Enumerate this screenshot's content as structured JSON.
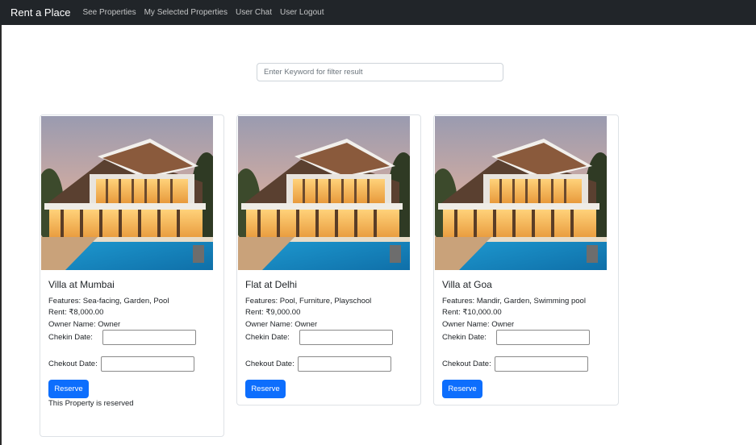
{
  "navbar": {
    "brand": "Rent a Place",
    "links": [
      {
        "label": "See Properties"
      },
      {
        "label": "My Selected Properties"
      },
      {
        "label": "User Chat"
      },
      {
        "label": "User Logout"
      }
    ]
  },
  "search": {
    "placeholder": "Enter Keyword for filter result",
    "value": ""
  },
  "properties": [
    {
      "title": "Villa at Mumbai",
      "features": "Features: Sea-facing, Garden, Pool",
      "rent": "Rent: ₹8,000.00",
      "owner": "Owner Name: Owner",
      "checkin_label": "Chekin Date:",
      "checkout_label": "Chekout Date:",
      "button_label": "Reserve",
      "status": "This Property is reserved"
    },
    {
      "title": "Flat at Delhi",
      "features": "Features: Pool, Furniture, Playschool",
      "rent": "Rent: ₹9,000.00",
      "owner": "Owner Name: Owner",
      "checkin_label": "Chekin Date:",
      "checkout_label": "Chekout Date:",
      "button_label": "Reserve"
    },
    {
      "title": "Villa at Goa",
      "features": "Features: Mandir, Garden, Swimming pool",
      "rent": "Rent: ₹10,000.00",
      "owner": "Owner Name: Owner",
      "checkin_label": "Chekin Date:",
      "checkout_label": "Chekout Date:",
      "button_label": "Reserve"
    }
  ],
  "colors": {
    "navbar_bg": "#212529",
    "primary_button": "#0d6efd"
  }
}
